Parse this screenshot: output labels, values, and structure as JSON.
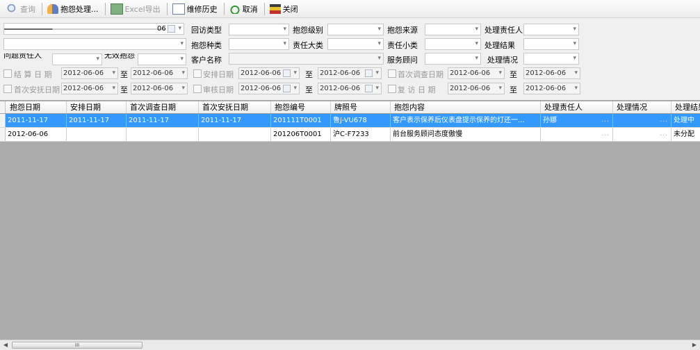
{
  "toolbar": {
    "query": "查询",
    "complaint_process": "抱怨处理...",
    "excel_export": "Excel导出",
    "repair_history": "维修历史",
    "cancel": "取消",
    "close": "关闭"
  },
  "filters": {
    "left_date_fragment": "06",
    "visit_type": "回访类型",
    "complaint_level": "抱怨级别",
    "complaint_source": "抱怨来源",
    "handler": "处理责任人",
    "complaint_kind": "抱怨种类",
    "resp_major": "责任大类",
    "resp_minor": "责任小类",
    "process_result": "处理结果",
    "row3_left_label": "问题责任人",
    "row3_mid_label": "无效抱怨",
    "customer_name": "客户名称",
    "service_advisor": "服务顾问",
    "process_status": "处理情况",
    "settle_date": "结 算 日 期",
    "arrange_date": "安排日期",
    "first_survey_date": "首次调查日期",
    "first_arrange_date": "首次安抚日期",
    "audit_date": "审核日期",
    "revisit_date": "复 访 日 期",
    "to": "至",
    "date_value": "2012-06-06"
  },
  "grid": {
    "columns": [
      "抱怨日期",
      "安排日期",
      "首次调查日期",
      "首次安抚日期",
      "抱怨编号",
      "牌照号",
      "抱怨内容",
      "处理责任人",
      "处理情况",
      "处理结果"
    ],
    "rows": [
      [
        "2011-11-17",
        "2011-11-17",
        "2011-11-17",
        "2011-11-17",
        "201111T0001",
        "鲁J-VU678",
        "客户表示保养后仪表盘提示保养的灯还一...",
        "孙娜",
        "",
        "处理中"
      ],
      [
        "2012-06-06",
        "",
        "",
        "",
        "201206T0001",
        "沪C-F7233",
        "前台服务顾问态度傲慢",
        "",
        "",
        "未分配"
      ]
    ]
  },
  "scrollbar": {
    "thumb_grip": "III"
  }
}
